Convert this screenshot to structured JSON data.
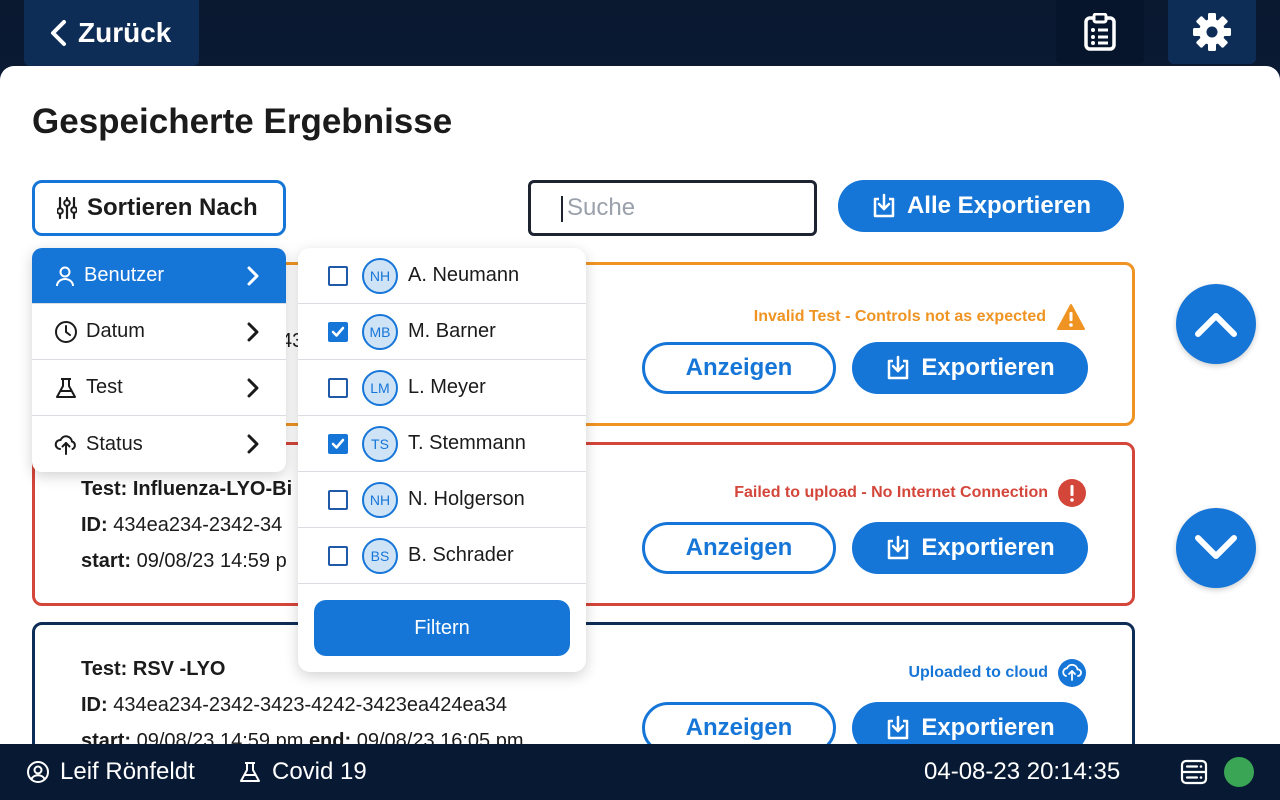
{
  "topbar": {
    "back_label": "Zurück"
  },
  "page": {
    "title": "Gespeicherte Ergebnisse"
  },
  "toolbar": {
    "sort_label": "Sortieren Nach",
    "search_placeholder": "Suche",
    "export_all_label": "Alle Exportieren"
  },
  "sort_menu": {
    "items": [
      {
        "label": "Benutzer",
        "icon": "user-icon"
      },
      {
        "label": "Datum",
        "icon": "clock-icon"
      },
      {
        "label": "Test",
        "icon": "flask-icon"
      },
      {
        "label": "Status",
        "icon": "cloud-upload-icon"
      }
    ]
  },
  "user_filter": {
    "users": [
      {
        "initials": "NH",
        "name": "A. Neumann",
        "checked": false
      },
      {
        "initials": "MB",
        "name": "M. Barner",
        "checked": true
      },
      {
        "initials": "LM",
        "name": "L. Meyer",
        "checked": false
      },
      {
        "initials": "TS",
        "name": "T. Stemmann",
        "checked": true
      },
      {
        "initials": "NH",
        "name": "N. Holgerson",
        "checked": false
      },
      {
        "initials": "BS",
        "name": "B. Schrader",
        "checked": false
      }
    ],
    "filter_label": "Filtern"
  },
  "results": [
    {
      "test_value": "",
      "id_value": "434",
      "start_value": "",
      "status_text": "Invalid Test - Controls not as expected",
      "status_color": "#ef9423",
      "view_label": "Anzeigen",
      "export_label": "Exportieren"
    },
    {
      "test_label": "Test:",
      "test_value": "Influenza-LYO-Bi",
      "id_label": "ID:",
      "id_value": "434ea234-2342-34",
      "start_label": "start:",
      "start_value": "09/08/23 14:59 p",
      "status_text": "Failed to upload - No Internet Connection",
      "status_color": "#d4453a",
      "view_label": "Anzeigen",
      "export_label": "Exportieren"
    },
    {
      "test_label": "Test:",
      "test_value": "RSV -LYO",
      "id_label": "ID:",
      "id_value": "434ea234-2342-3423-4242-3423ea424ea34",
      "start_label": "start:",
      "start_value": "09/08/23 14:59 pm",
      "end_label": "end:",
      "end_value": "09/08/23 16:05 pm",
      "status_text": "Uploaded to cloud",
      "status_color": "#1676d8",
      "view_label": "Anzeigen",
      "export_label": "Exportieren"
    }
  ],
  "statusbar": {
    "user": "Leif Rönfeldt",
    "test": "Covid 19",
    "datetime": "04-08-23 20:14:35",
    "connection_color": "#3aa655"
  }
}
